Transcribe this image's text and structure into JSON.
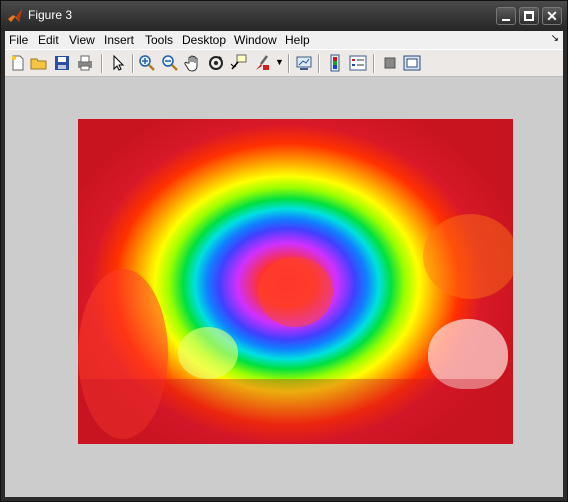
{
  "window": {
    "title": "Figure 3"
  },
  "menu": [
    "File",
    "Edit",
    "View",
    "Insert",
    "Tools",
    "Desktop",
    "Window",
    "Help"
  ],
  "toolbar": {
    "buttons": [
      "new-figure",
      "open-file",
      "save",
      "print",
      "edit-plot",
      "zoom-in",
      "zoom-out",
      "pan",
      "rotate-3d",
      "data-cursor",
      "brush",
      "link-plot",
      "colorbar",
      "legend",
      "hide-plot-tools",
      "show-plot-tools"
    ]
  },
  "figure": {
    "content": "heat map overlay on image of peppers and garlic"
  }
}
